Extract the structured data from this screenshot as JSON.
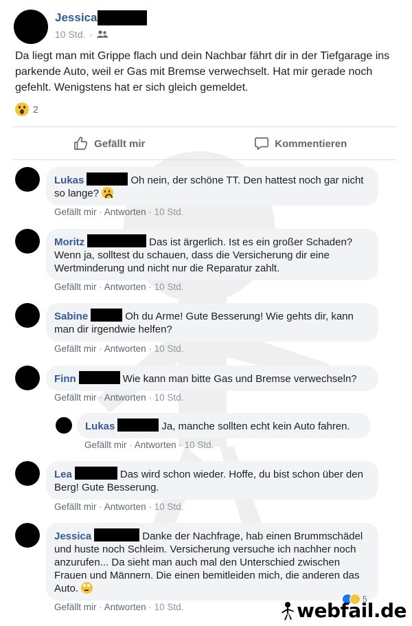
{
  "post": {
    "author": "Jessica",
    "time": "10 Std.",
    "audience_icon": "friends-icon",
    "text": "Da liegt man mit Grippe flach und dein Nachbar fährt dir in der Tiefgarage ins parkende Auto, weil er Gas mit Bremse verwechselt. Hat mir gerade noch gefehlt. Wenigstens hat er sich gleich gemeldet.",
    "reaction_icon": "wow-emoji",
    "reaction_count": "2"
  },
  "actions": {
    "like_label": "Gefällt mir",
    "comment_label": "Kommentieren"
  },
  "comment_actions": {
    "like": "Gefällt mir",
    "reply": "Antworten",
    "sep": "·"
  },
  "comments": [
    {
      "name": "Lukas",
      "text": "Oh nein, der schöne TT. Den hattest noch gar nicht so lange?",
      "time": "10 Std."
    },
    {
      "name": "Moritz",
      "text": "Das ist ärgerlich. Ist es ein großer Schaden? Wenn ja, solltest du schauen, dass die Versicherung dir eine Wertminderung und nicht nur die Reparatur zahlt.",
      "time": "10 Std."
    },
    {
      "name": "Sabine",
      "text": "Oh du Arme! Gute Besserung! Wie gehts dir, kann man dir irgendwie helfen?",
      "time": "10 Std."
    },
    {
      "name": "Finn",
      "text": "Wie kann man bitte Gas und Bremse verwechseln?",
      "time": "10 Std."
    },
    {
      "name": "Lukas",
      "text": "Ja, manche sollten echt kein Auto fahren.",
      "time": "10 Std."
    },
    {
      "name": "Lea",
      "text": "Das wird schon wieder. Hoffe, du bist schon über den Berg! Gute Besserung.",
      "time": "10 Std."
    },
    {
      "name": "Jessica",
      "text": "Danke der Nachfrage, hab einen Brummschädel und huste noch Schleim. Versicherung versuche ich nachher noch anzurufen... Da sieht man auch mal den Unterschied zwischen Frauen und Männern. Die einen bemitleiden mich, die anderen das Auto.",
      "time": "10 Std.",
      "reaction_count": "5"
    }
  ],
  "watermark": "webfail.de"
}
